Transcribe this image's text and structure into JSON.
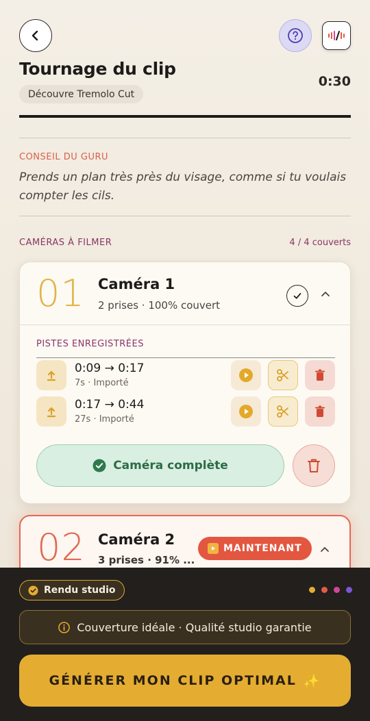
{
  "header": {
    "title": "Tournage du clip",
    "subtitle": "Découvre Tremolo Cut",
    "timer": "0:30",
    "progress_fraction": 1.0
  },
  "tip": {
    "label": "CONSEIL DU GURU",
    "text": "Prends un plan très près du visage, comme si tu voulais compter les cils."
  },
  "cameras_section": {
    "label": "CAMÉRAS À FILMER",
    "count": "4 / 4 couverts"
  },
  "camera1": {
    "number": "01",
    "name": "Caméra 1",
    "meta": "2 prises · 100% couvert",
    "tracks_label": "PISTES ENREGISTRÉES",
    "tracks": [
      {
        "range": "0:09 → 0:17",
        "detail": "7s · Importé"
      },
      {
        "range": "0:17 → 0:44",
        "detail": "27s · Importé"
      }
    ],
    "complete_label": "Caméra complète"
  },
  "camera2": {
    "number": "02",
    "name": "Caméra 2",
    "meta": "3 prises · 91% ...",
    "badge": "MAINTENANT"
  },
  "bottom": {
    "studio_label": "Rendu studio",
    "dot_colors": [
      "#e4ad32",
      "#e35b4a",
      "#d1469b",
      "#7a56d6"
    ],
    "info": "Couverture idéale · Qualité studio garantie",
    "generate_label": "GÉNÉRER MON CLIP OPTIMAL",
    "generate_emoji": "✨"
  },
  "icons": {
    "back": "chevron-left-icon",
    "help": "question-circle-icon",
    "waveform": "waveform-icon"
  }
}
